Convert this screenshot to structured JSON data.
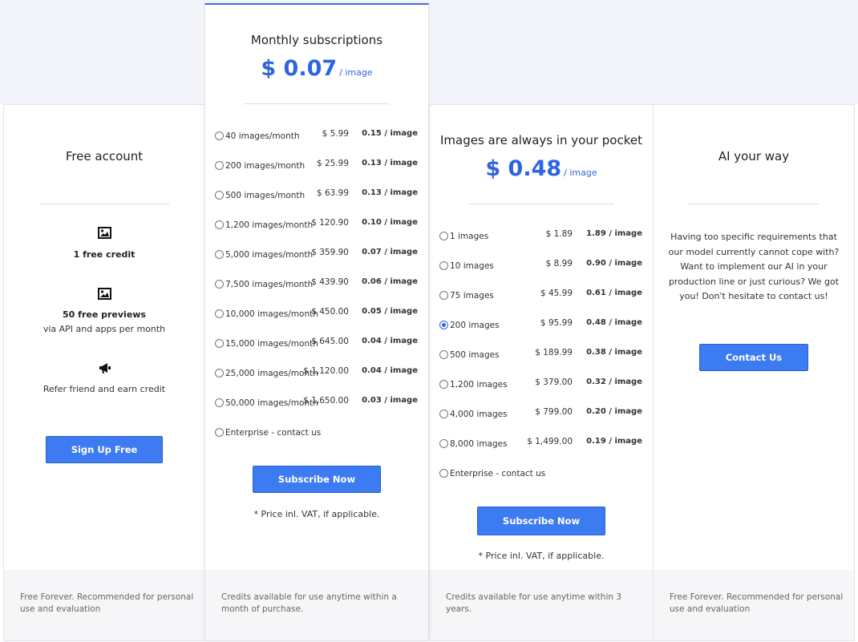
{
  "free": {
    "title": "Free account",
    "features": [
      {
        "icon": "image-icon",
        "bold": "1 free credit",
        "text": ""
      },
      {
        "icon": "image-icon",
        "bold": "50 free previews",
        "text": "via API and apps per month"
      },
      {
        "icon": "megaphone-icon",
        "bold": "",
        "text": "Refer friend and earn credit"
      }
    ],
    "button": "Sign Up Free",
    "footer": "Free Forever. Recommended for personal use and evaluation"
  },
  "monthly": {
    "title": "Monthly subscriptions",
    "price": "$ 0.07",
    "per": "/ image",
    "options": [
      {
        "label": "40 images/month",
        "amount": "$ 5.99",
        "per_image": "0.15 / image",
        "selected": false
      },
      {
        "label": "200 images/month",
        "amount": "$ 25.99",
        "per_image": "0.13 / image",
        "selected": false
      },
      {
        "label": "500 images/month",
        "amount": "$ 63.99",
        "per_image": "0.13 / image",
        "selected": false
      },
      {
        "label": "1,200 images/month",
        "amount": "$ 120.90",
        "per_image": "0.10 / image",
        "selected": false
      },
      {
        "label": "5,000 images/month",
        "amount": "$ 359.90",
        "per_image": "0.07 / image",
        "selected": false
      },
      {
        "label": "7,500 images/month",
        "amount": "$ 439.90",
        "per_image": "0.06 / image",
        "selected": false
      },
      {
        "label": "10,000 images/month",
        "amount": "$ 450.00",
        "per_image": "0.05 / image",
        "selected": false
      },
      {
        "label": "15,000 images/month",
        "amount": "$ 645.00",
        "per_image": "0.04 / image",
        "selected": false
      },
      {
        "label": "25,000 images/month",
        "amount": "$ 1,120.00",
        "per_image": "0.04 / image",
        "selected": false
      },
      {
        "label": "50,000 images/month",
        "amount": "$ 1,650.00",
        "per_image": "0.03 / image",
        "selected": false
      },
      {
        "label": "Enterprise - contact us",
        "amount": "",
        "per_image": "",
        "selected": false
      }
    ],
    "button": "Subscribe Now",
    "note": "* Price inl. VAT, if applicable.",
    "footer": "Credits available for use anytime within a month of purchase."
  },
  "pocket": {
    "title": "Images are always in your pocket",
    "price": "$ 0.48",
    "per": "/ image",
    "options": [
      {
        "label": "1 images",
        "amount": "$ 1.89",
        "per_image": "1.89 / image",
        "selected": false
      },
      {
        "label": "10 images",
        "amount": "$ 8.99",
        "per_image": "0.90 / image",
        "selected": false
      },
      {
        "label": "75 images",
        "amount": "$ 45.99",
        "per_image": "0.61 / image",
        "selected": false
      },
      {
        "label": "200 images",
        "amount": "$ 95.99",
        "per_image": "0.48 / image",
        "selected": true
      },
      {
        "label": "500 images",
        "amount": "$ 189.99",
        "per_image": "0.38 / image",
        "selected": false
      },
      {
        "label": "1,200 images",
        "amount": "$ 379.00",
        "per_image": "0.32 / image",
        "selected": false
      },
      {
        "label": "4,000 images",
        "amount": "$ 799.00",
        "per_image": "0.20 / image",
        "selected": false
      },
      {
        "label": "8,000 images",
        "amount": "$ 1,499.00",
        "per_image": "0.19 / image",
        "selected": false
      },
      {
        "label": "Enterprise - contact us",
        "amount": "",
        "per_image": "",
        "selected": false
      }
    ],
    "button": "Subscribe Now",
    "note": "* Price inl. VAT, if applicable.",
    "footer": "Credits available for use anytime within 3 years."
  },
  "ai": {
    "title": "AI your way",
    "text": "Having too specific requirements that our model currently cannot cope with? Want to implement our AI in your production line or just curious? We got you! Don't hesitate to contact us!",
    "button": "Contact Us",
    "footer": "Free Forever. Recommended for personal use and evaluation"
  },
  "colors": {
    "accent": "#2f64e0",
    "button": "#3d7bf2"
  }
}
